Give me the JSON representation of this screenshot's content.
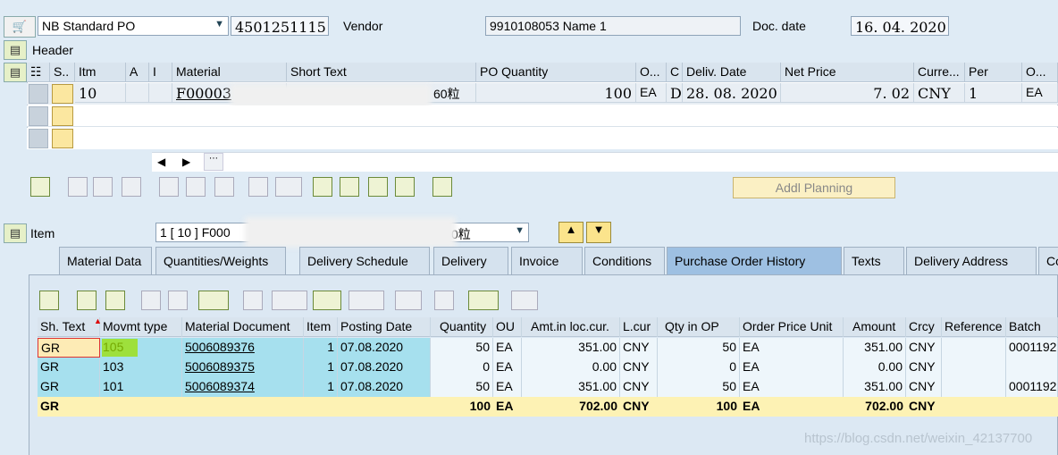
{
  "header": {
    "doc_type": "NB Standard PO",
    "po_number": "4501251115",
    "vendor_label": "Vendor",
    "vendor_value": "9910108053 Name 1",
    "doc_date_label": "Doc. date",
    "doc_date_value": "16. 04. 2020",
    "header_section": "Header"
  },
  "items_grid": {
    "columns": [
      "S..",
      "Itm",
      "A",
      "I",
      "Material",
      "Short Text",
      "PO Quantity",
      "O...",
      "C",
      "Deliv. Date",
      "Net Price",
      "Curre...",
      "Per",
      "O..."
    ],
    "row": {
      "itm": "10",
      "material": "F00003",
      "short_text_suffix": "60粒",
      "po_qty": "100",
      "unit": "EA",
      "cat": "D",
      "deliv_date": "28. 08. 2020",
      "net_price": "7. 02",
      "currency": "CNY",
      "per": "1",
      "order_unit": "EA"
    },
    "addl_planning": "Addl Planning"
  },
  "item_section": {
    "label": "Item",
    "selector_prefix": "1 [ 10 ] F000",
    "selector_suffix": "0粒"
  },
  "tabs": [
    "Material Data",
    "Quantities/Weights",
    "Delivery Schedule",
    "Delivery",
    "Invoice",
    "Conditions",
    "Purchase Order History",
    "Texts",
    "Delivery Address",
    "Co"
  ],
  "history": {
    "columns": [
      "Sh. Text",
      "Movmt type",
      "Material Document",
      "Item",
      "Posting Date",
      "Quantity",
      "OU",
      "Amt.in loc.cur.",
      "L.cur",
      "Qty in OP",
      "Order Price Unit",
      "Amount",
      "Crcy",
      "Reference",
      "Batch"
    ],
    "rows": [
      {
        "sh": "GR",
        "mvt": "105",
        "doc": "5006089376",
        "item": "1",
        "date": "07.08.2020",
        "qty": "50",
        "ou": "EA",
        "amt": "351.00",
        "lcur": "CNY",
        "qop": "50",
        "opu": "EA",
        "amount": "351.00",
        "crcy": "CNY",
        "ref": "",
        "batch": "0001192"
      },
      {
        "sh": "GR",
        "mvt": "103",
        "doc": "5006089375",
        "item": "1",
        "date": "07.08.2020",
        "qty": "0",
        "ou": "EA",
        "amt": "0.00",
        "lcur": "CNY",
        "qop": "0",
        "opu": "EA",
        "amount": "0.00",
        "crcy": "CNY",
        "ref": "",
        "batch": ""
      },
      {
        "sh": "GR",
        "mvt": "101",
        "doc": "5006089374",
        "item": "1",
        "date": "07.08.2020",
        "qty": "50",
        "ou": "EA",
        "amt": "351.00",
        "lcur": "CNY",
        "qop": "50",
        "opu": "EA",
        "amount": "351.00",
        "crcy": "CNY",
        "ref": "",
        "batch": "0001192"
      }
    ],
    "total": {
      "sh": "GR",
      "qty": "100",
      "ou": "EA",
      "amt": "702.00",
      "lcur": "CNY",
      "qop": "100",
      "opu": "EA",
      "amount": "702.00",
      "crcy": "CNY"
    }
  },
  "watermark": "https://blog.csdn.net/weixin_42137700"
}
